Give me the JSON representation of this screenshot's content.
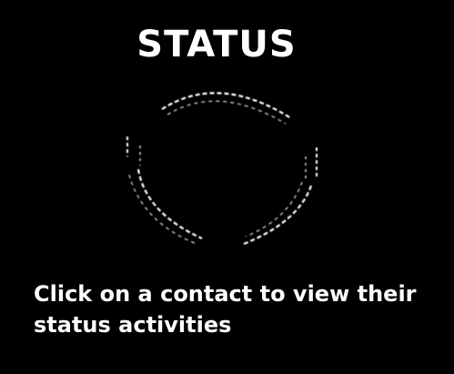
{
  "screen": {
    "title": "STATUS",
    "icon": "status-ring-icon",
    "hint": "Click on a contact to view their status activities"
  },
  "colors": {
    "background": "#000000",
    "foreground": "#ffffff"
  }
}
